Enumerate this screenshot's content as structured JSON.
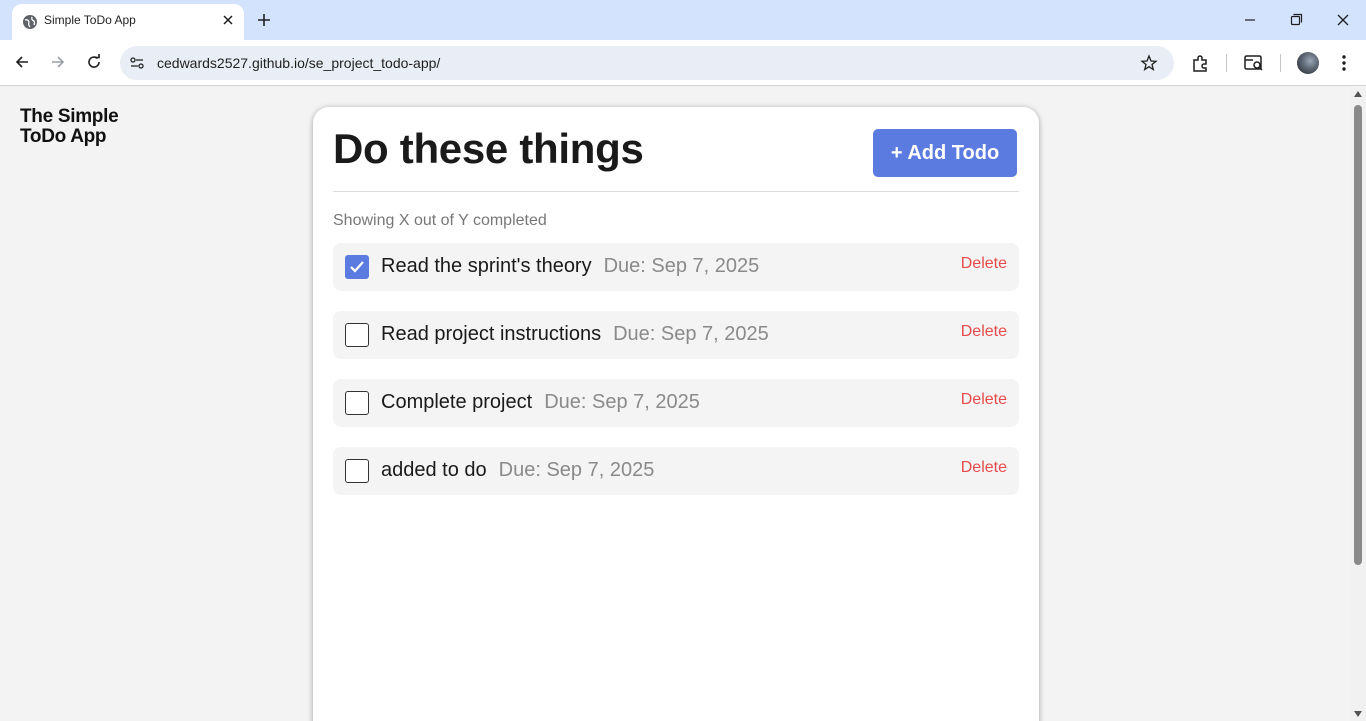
{
  "browser": {
    "tab_title": "Simple ToDo App",
    "url": "cedwards2527.github.io/se_project_todo-app/",
    "icons": [
      "globe-icon",
      "close-icon",
      "plus-icon",
      "minimize-icon",
      "restore-icon",
      "close-window-icon",
      "back-icon",
      "forward-icon",
      "reload-icon",
      "site-info-icon",
      "star-icon",
      "extensions-icon",
      "tab-search-icon",
      "menu-icon"
    ]
  },
  "app": {
    "brand_line1": "The Simple",
    "brand_line2": "ToDo App",
    "heading": "Do these things",
    "add_button": "+ Add Todo",
    "counter": "Showing X out of Y completed",
    "delete_label": "Delete",
    "todos": [
      {
        "title": "Read the sprint's theory",
        "due": "Due: Sep 7, 2025",
        "completed": true
      },
      {
        "title": "Read project instructions",
        "due": "Due: Sep 7, 2025",
        "completed": false
      },
      {
        "title": "Complete project",
        "due": "Due: Sep 7, 2025",
        "completed": false
      },
      {
        "title": "added to do",
        "due": "Due: Sep 7, 2025",
        "completed": false
      }
    ]
  },
  "colors": {
    "accent": "#5b7be0",
    "delete": "#e64b4b",
    "tabstrip": "#d3e3fd"
  }
}
